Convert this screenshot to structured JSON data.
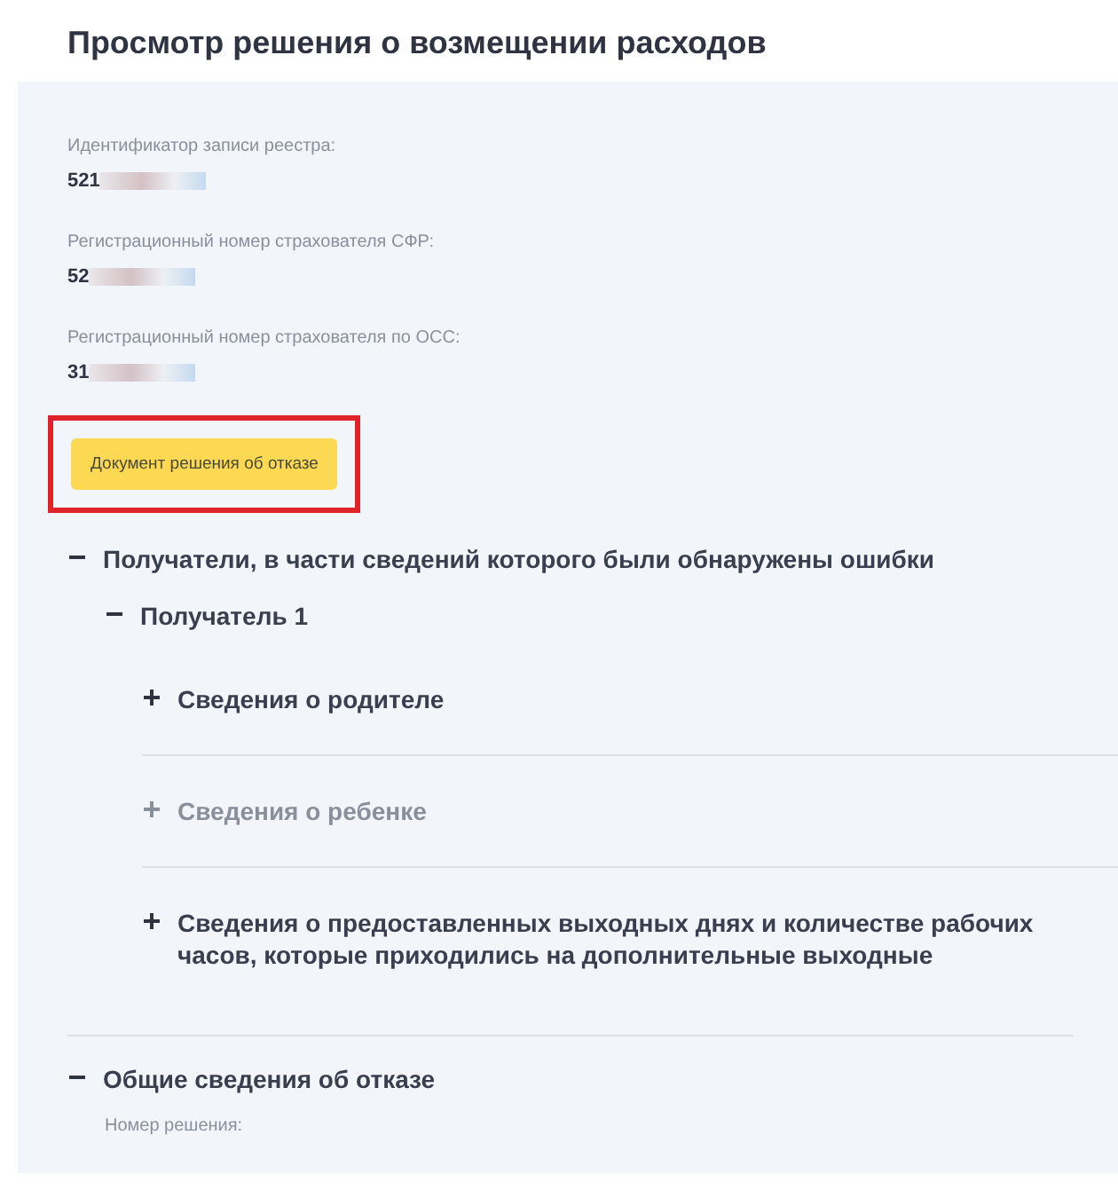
{
  "page_title": "Просмотр решения о возмещении расходов",
  "fields": [
    {
      "label": "Идентификатор записи реестра:",
      "value": "521"
    },
    {
      "label": "Регистрационный номер страхователя СФР:",
      "value": "52"
    },
    {
      "label": "Регистрационный номер страхователя по ОСС:",
      "value": "31"
    }
  ],
  "document_button": {
    "label": "Документ решения об отказе",
    "highlighted": true
  },
  "sections": [
    {
      "title": "Получатели, в части сведений которого были обнаружены ошибки",
      "expanded": true,
      "disabled": false,
      "children": [
        {
          "title": "Получатель 1",
          "expanded": true,
          "disabled": false,
          "children": [
            {
              "title": "Сведения о родителе",
              "expanded": false,
              "disabled": false
            },
            {
              "title": "Сведения о ребенке",
              "expanded": false,
              "disabled": true
            },
            {
              "title": "Сведения о предоставленных выходных днях и количестве рабочих часов, которые приходились на дополнительные выходные",
              "expanded": false,
              "disabled": false
            }
          ]
        }
      ]
    },
    {
      "title": "Общие сведения об отказе",
      "expanded": true,
      "disabled": false,
      "fields": [
        {
          "label": "Номер решения:"
        }
      ]
    }
  ]
}
